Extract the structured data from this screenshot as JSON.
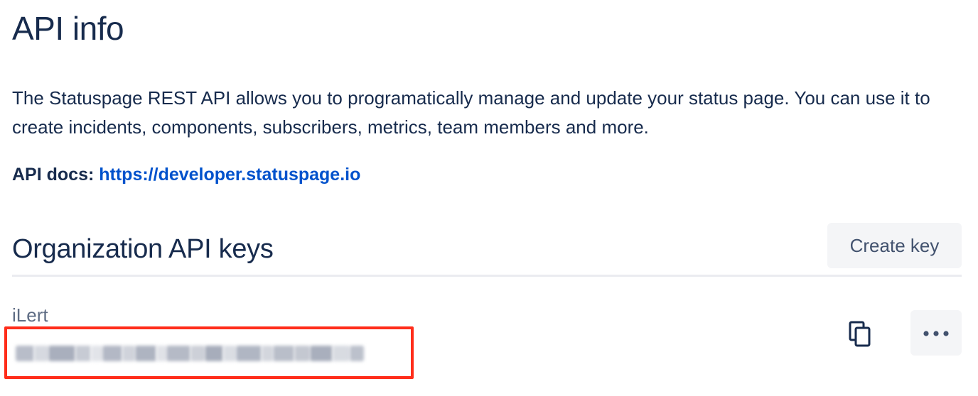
{
  "page": {
    "title": "API info",
    "description": "The Statuspage REST API allows you to programatically manage and update your status page. You can use it to create incidents, components, subscribers, metrics, team members and more.",
    "docs_label": "API docs:",
    "docs_link": "https://developer.statuspage.io"
  },
  "org_keys": {
    "title": "Organization API keys",
    "create_label": "Create key",
    "keys": [
      {
        "name": "iLert",
        "value_redacted": true
      }
    ]
  },
  "icons": {
    "copy": "copy-icon",
    "more": "more-horizontal-icon"
  },
  "colors": {
    "text": "#172b4d",
    "link": "#0052cc",
    "highlight_border": "#ff2d1a",
    "button_bg": "#f4f5f7"
  }
}
